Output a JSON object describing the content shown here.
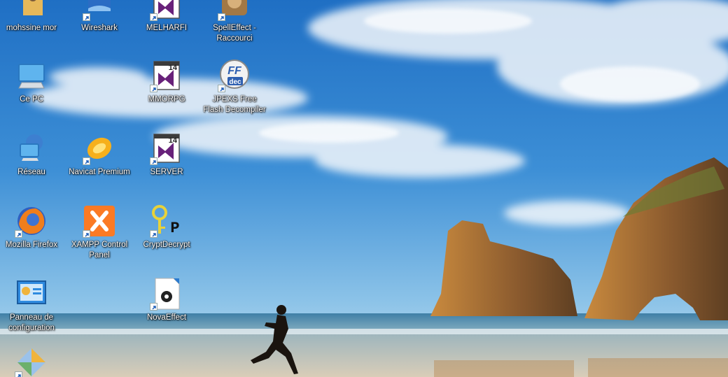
{
  "desktop": {
    "icons": [
      {
        "label": "mohssine mor",
        "icon": "user-folder-icon",
        "shortcut": false
      },
      {
        "label": "Wireshark",
        "icon": "wireshark-icon",
        "shortcut": true
      },
      {
        "label": "MELHARFI",
        "icon": "visual-studio-icon",
        "shortcut": true
      },
      {
        "label": "SpellEffect - Raccourci",
        "icon": "spelleffect-icon",
        "shortcut": true
      },
      {
        "label": "Ce PC",
        "icon": "computer-icon",
        "shortcut": false
      },
      {
        "label": "MMORPG",
        "icon": "visual-studio-icon",
        "shortcut": true
      },
      {
        "label": "JPEXS Free Flash Decompiler",
        "icon": "ffdec-icon",
        "shortcut": true
      },
      {
        "label": "Réseau",
        "icon": "network-icon",
        "shortcut": false
      },
      {
        "label": "Navicat Premium",
        "icon": "navicat-icon",
        "shortcut": true
      },
      {
        "label": "SERVER",
        "icon": "visual-studio-icon",
        "shortcut": true
      },
      {
        "label": "Mozilla Firefox",
        "icon": "firefox-icon",
        "shortcut": true
      },
      {
        "label": "XAMPP Control Panel",
        "icon": "xampp-icon",
        "shortcut": true
      },
      {
        "label": "CryptDecrypt",
        "icon": "key-icon",
        "shortcut": true
      },
      {
        "label": "Panneau de configuration",
        "icon": "control-panel-icon",
        "shortcut": false
      },
      {
        "label": "NovaEffect",
        "icon": "gear-file-icon",
        "shortcut": true
      },
      {
        "label": "",
        "icon": "recycle-bin-icon",
        "shortcut": true
      }
    ],
    "badge_text": {
      "vs_version": "14",
      "ffdec_top": "FF",
      "ffdec_bottom": "dec",
      "crypt_letter": "P"
    }
  }
}
